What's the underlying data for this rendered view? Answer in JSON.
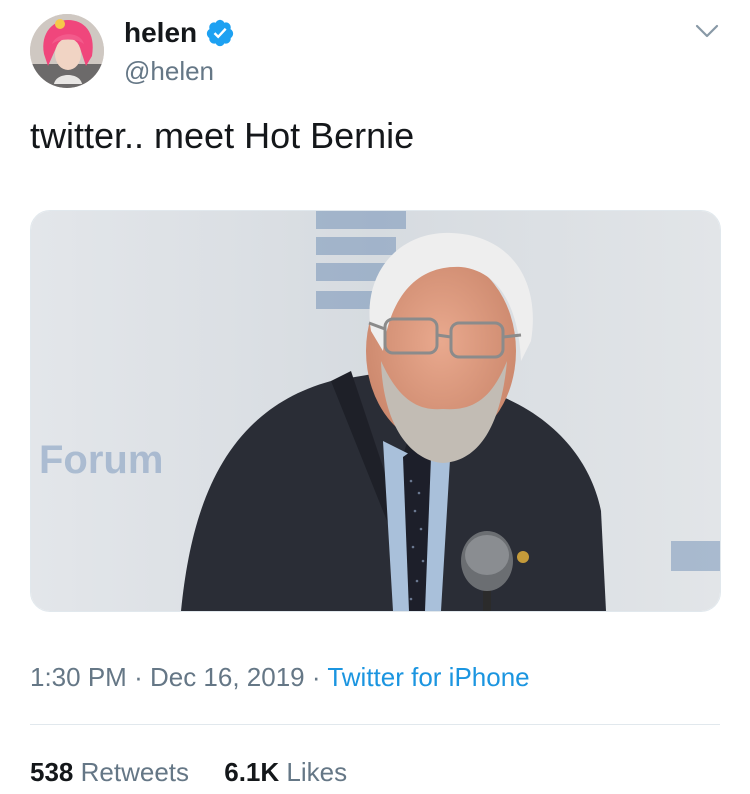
{
  "tweet": {
    "author": {
      "display_name": "helen",
      "handle": "@helen",
      "verified": true,
      "verified_icon": "verified-badge-icon",
      "avatar_icon": "avatar-photo"
    },
    "text": "twitter.. meet Hot Bernie",
    "media": {
      "background_text": "Forum"
    },
    "meta": {
      "time": "1:30 PM",
      "separator": "·",
      "date": "Dec 16, 2019",
      "source": "Twitter for iPhone"
    },
    "stats": {
      "retweets_count": "538",
      "retweets_label": "Retweets",
      "likes_count": "6.1K",
      "likes_label": "Likes"
    },
    "colors": {
      "link": "#1b95e0",
      "secondary_text": "#657786",
      "verified_blue": "#1da1f2"
    }
  }
}
